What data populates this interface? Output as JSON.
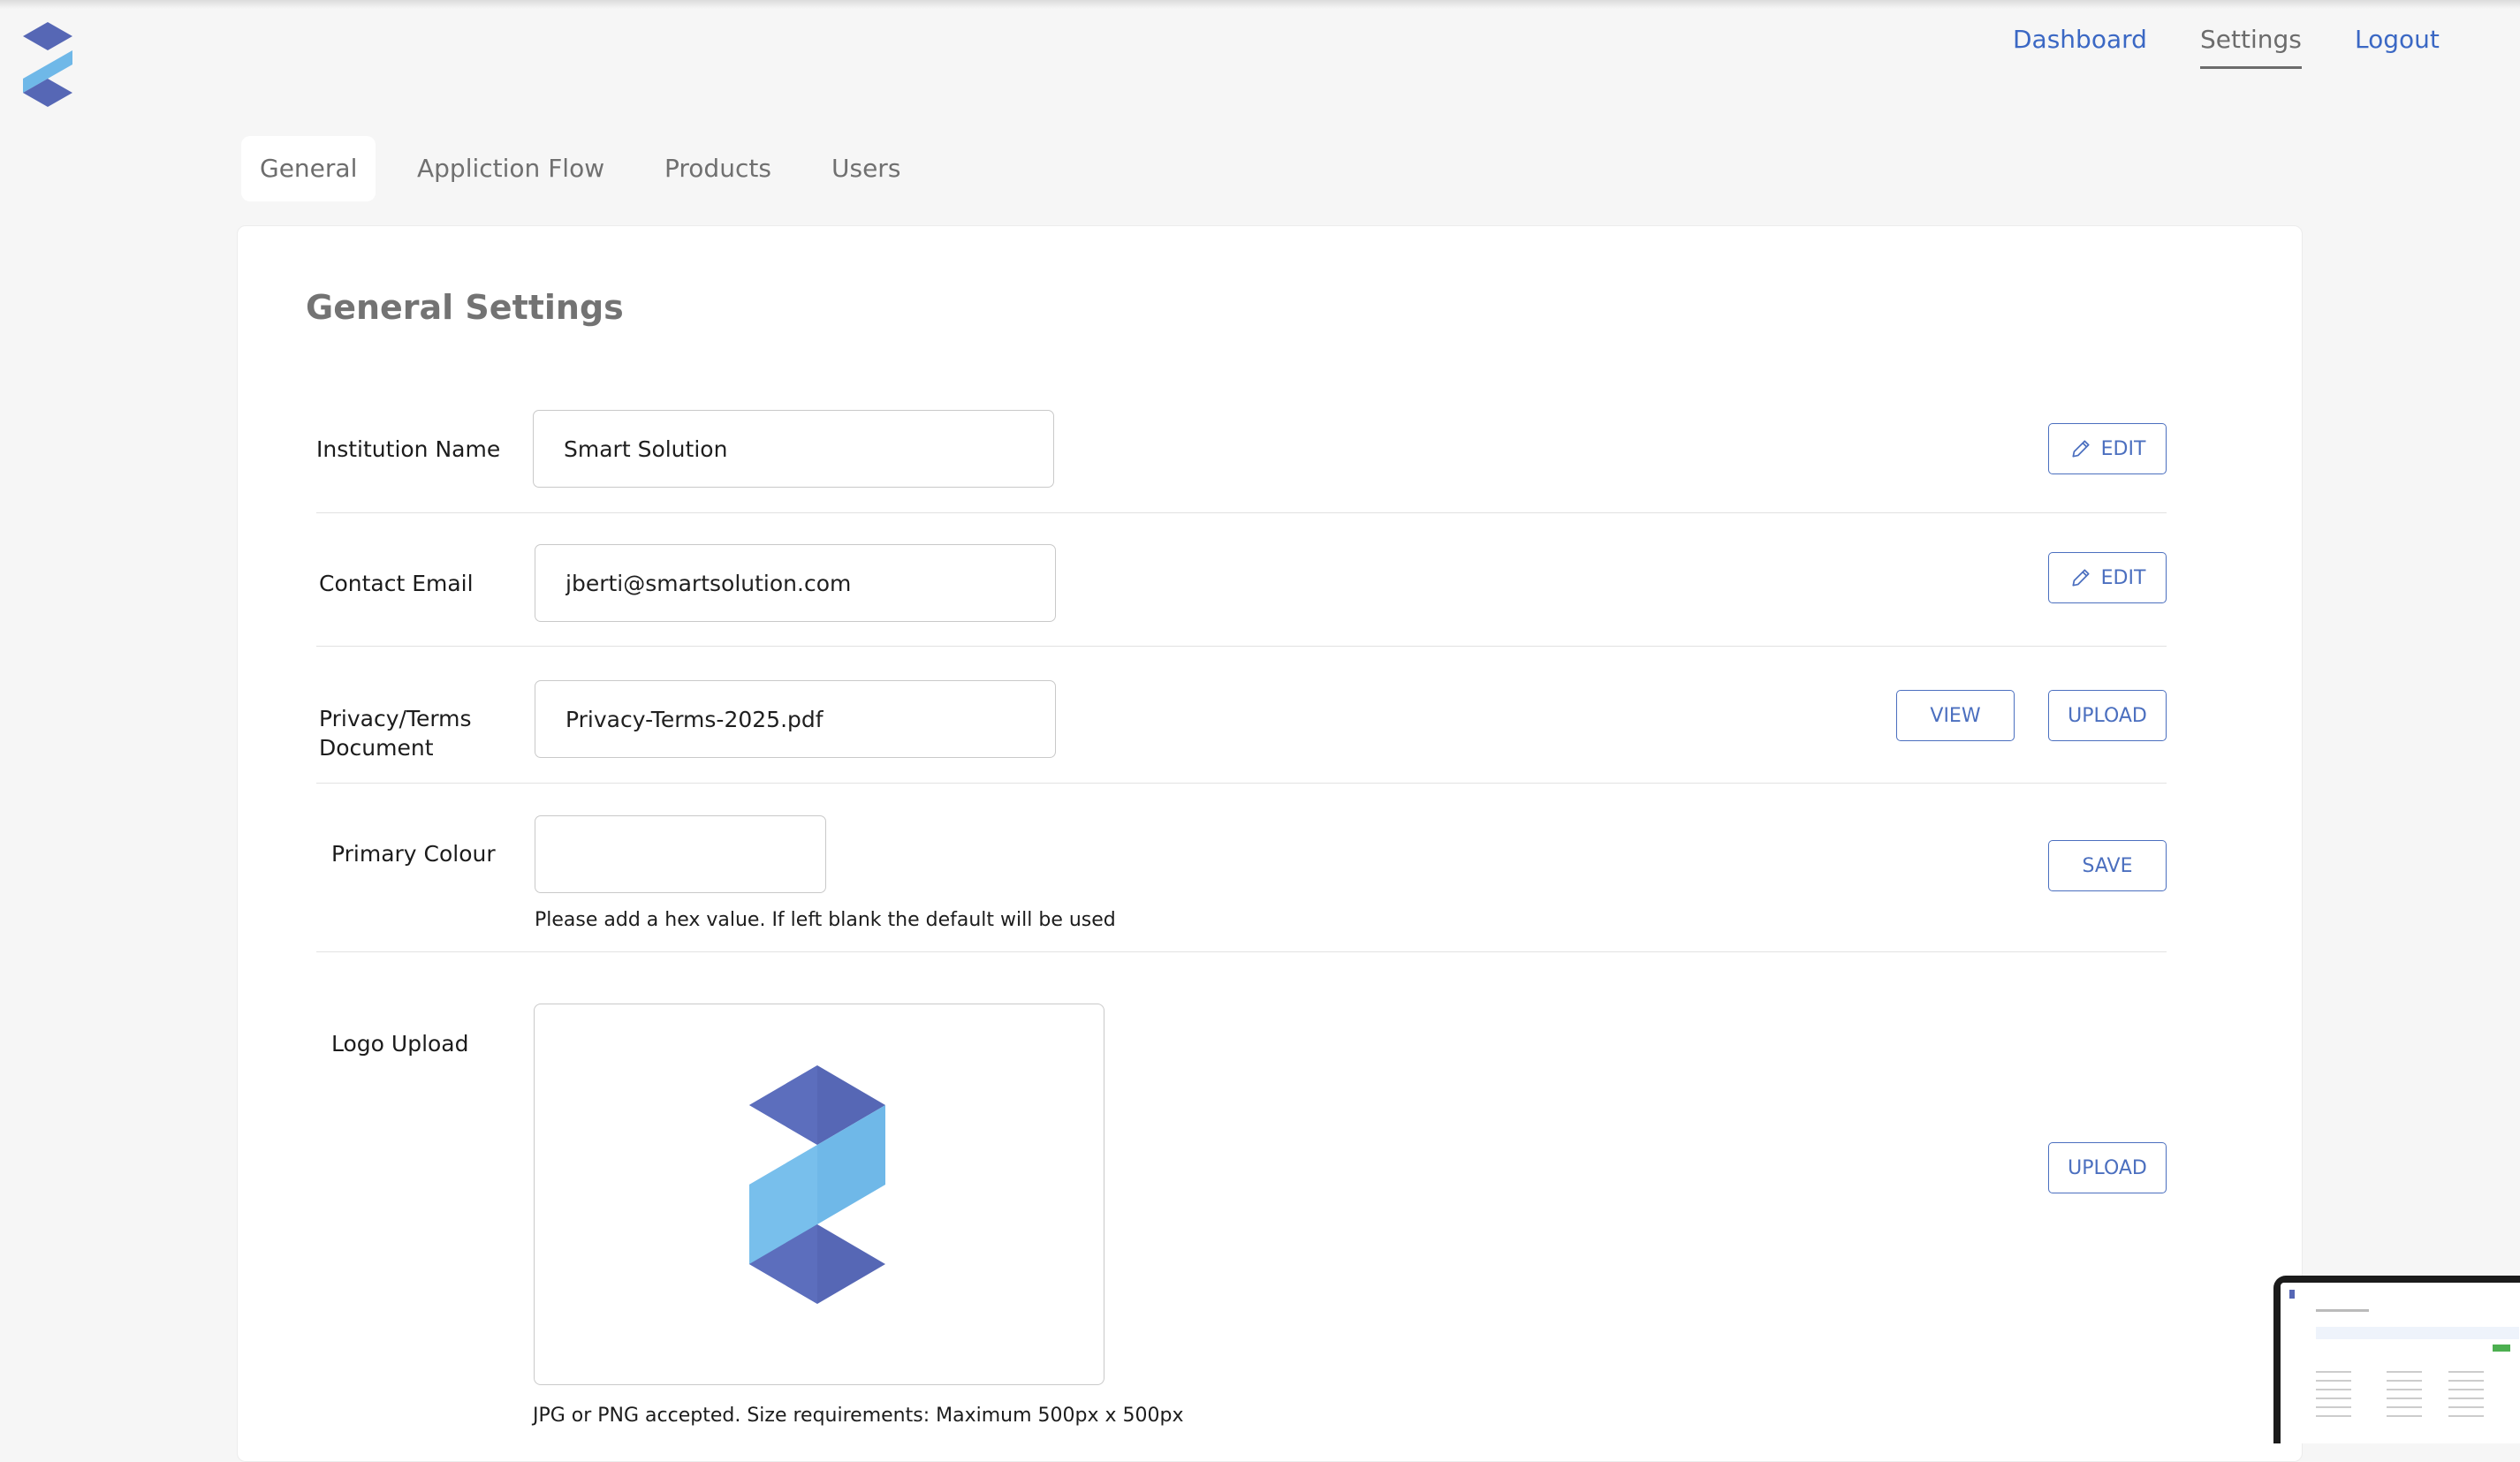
{
  "nav": {
    "dashboard": "Dashboard",
    "settings": "Settings",
    "logout": "Logout"
  },
  "tabs": [
    "General",
    "Appliction Flow",
    "Products",
    "Users"
  ],
  "page_title": "General Settings",
  "rows": {
    "institution": {
      "label": "Institution Name",
      "value": "Smart Solution",
      "button": "EDIT"
    },
    "email": {
      "label": "Contact Email",
      "value": "jberti@smartsolution.com",
      "button": "EDIT"
    },
    "privacy": {
      "label_line1": "Privacy/Terms",
      "label_line2": "Document",
      "value": "Privacy-Terms-2025.pdf",
      "view_button": "VIEW",
      "upload_button": "UPLOAD"
    },
    "colour": {
      "label": "Primary Colour",
      "value": "",
      "hint": "Please add a hex value. If left blank the default will be used",
      "button": "SAVE"
    },
    "logo": {
      "label": "Logo Upload",
      "button": "UPLOAD",
      "hint": "JPG or PNG accepted. Size requirements: Maximum 500px x 500px"
    }
  },
  "colors": {
    "logo_dark": "#5667b5",
    "logo_light": "#6fb8e8",
    "link": "#3b68c4",
    "button": "#4b6fbf"
  }
}
